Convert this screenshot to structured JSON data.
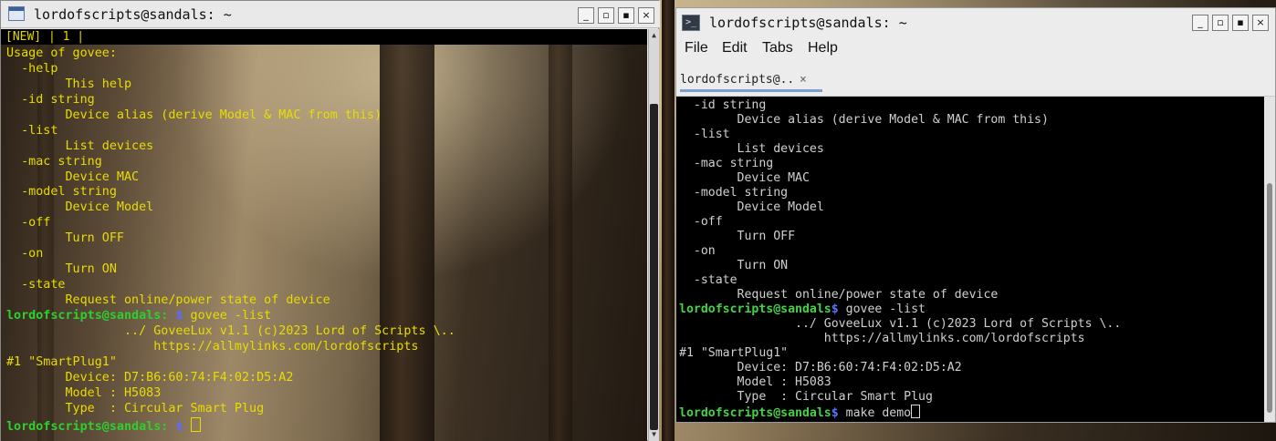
{
  "left_terminal": {
    "title": "lordofscripts@sandals: ~",
    "tabline": "[NEW] | 1 |",
    "lines": [
      {
        "text": "Usage of govee:"
      },
      {
        "text": "  -help"
      },
      {
        "text": "        This help"
      },
      {
        "text": "  -id string"
      },
      {
        "text": "        Device alias (derive Model & MAC from this)"
      },
      {
        "text": "  -list"
      },
      {
        "text": "        List devices"
      },
      {
        "text": "  -mac string"
      },
      {
        "text": "        Device MAC"
      },
      {
        "text": "  -model string"
      },
      {
        "text": "        Device Model"
      },
      {
        "text": "  -off"
      },
      {
        "text": "        Turn OFF"
      },
      {
        "text": "  -on"
      },
      {
        "text": "        Turn ON"
      },
      {
        "text": "  -state"
      },
      {
        "text": "        Request online/power state of device"
      },
      {
        "prompt": "lordofscripts@sandals:",
        "sym": " $",
        "cmd": " govee -list"
      },
      {
        "text": "                ../ GoveeLux v1.1 (c)2023 Lord of Scripts \\.."
      },
      {
        "text": "                    https://allmylinks.com/lordofscripts"
      },
      {
        "text": "#1 \"SmartPlug1\""
      },
      {
        "text": "        Device: D7:B6:60:74:F4:02:D5:A2"
      },
      {
        "text": "        Model : H5083"
      },
      {
        "text": "        Type  : Circular Smart Plug"
      },
      {
        "prompt": "lordofscripts@sandals:",
        "sym": " $",
        "cmd": " ",
        "cursor": true
      }
    ]
  },
  "right_terminal": {
    "title": "lordofscripts@sandals: ~",
    "menu": [
      "File",
      "Edit",
      "Tabs",
      "Help"
    ],
    "tab_label": "lordofscripts@..",
    "tab_close": "×",
    "lines": [
      {
        "text": "  -id string"
      },
      {
        "text": "        Device alias (derive Model & MAC from this)"
      },
      {
        "text": "  -list"
      },
      {
        "text": "        List devices"
      },
      {
        "text": "  -mac string"
      },
      {
        "text": "        Device MAC"
      },
      {
        "text": "  -model string"
      },
      {
        "text": "        Device Model"
      },
      {
        "text": "  -off"
      },
      {
        "text": "        Turn OFF"
      },
      {
        "text": "  -on"
      },
      {
        "text": "        Turn ON"
      },
      {
        "text": "  -state"
      },
      {
        "text": "        Request online/power state of device"
      },
      {
        "prompt": "lordofscripts@sandals",
        "sym": "$",
        "cmd": " govee -list"
      },
      {
        "text": "                ../ GoveeLux v1.1 (c)2023 Lord of Scripts \\.."
      },
      {
        "text": "                    https://allmylinks.com/lordofscripts"
      },
      {
        "text": "#1 \"SmartPlug1\""
      },
      {
        "text": "        Device: D7:B6:60:74:F4:02:D5:A2"
      },
      {
        "text": "        Model : H5083"
      },
      {
        "text": "        Type  : Circular Smart Plug"
      },
      {
        "prompt": "lordofscripts@sandals",
        "sym": "$",
        "cmd": " make demo",
        "cursor": true
      }
    ]
  },
  "window_buttons": {
    "minimize": "_",
    "restore": "▫",
    "maximize": "▪",
    "close": "×"
  },
  "colors": {
    "xterm_text": "#e8dc00",
    "prompt_user": "#2ecf2e",
    "prompt_symbol": "#5a6cff",
    "lx_text": "#cfcfcf"
  }
}
